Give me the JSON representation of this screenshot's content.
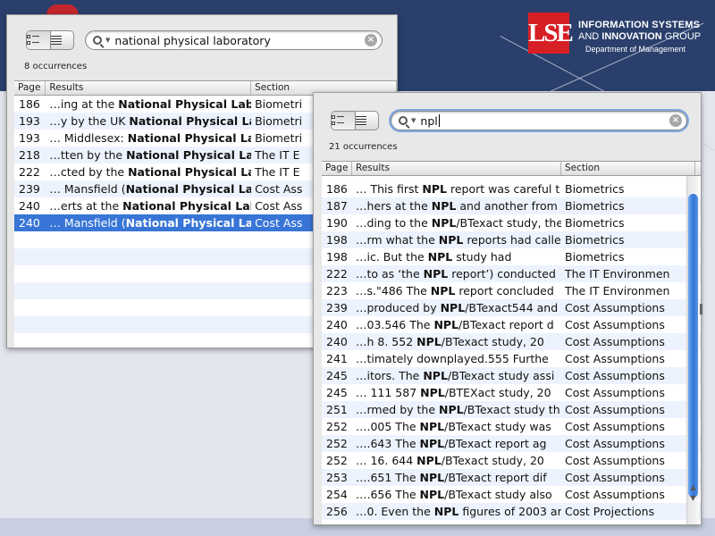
{
  "brand": {
    "logo_text": "LSE",
    "line1": "INFORMATION SYSTEMS",
    "line2a": "AND ",
    "line2b": "INNOVATION",
    "line2c": " GROUP",
    "line3": "Department of Management",
    "colors": {
      "lse_red": "#d71f26",
      "header_navy": "#2a3f6b",
      "selection_blue": "#3875d7"
    }
  },
  "window1": {
    "search_query": "national physical laboratory",
    "occurrences": "8 occurrences",
    "columns": [
      "Page",
      "Results",
      "Section"
    ],
    "rows": [
      {
        "page": "186",
        "pre": "…ing at the ",
        "bold": "National Physical Labo",
        "post": "",
        "section": "Biometri"
      },
      {
        "page": "193",
        "pre": "…y by the UK ",
        "bold": "National Physical Lab",
        "post": "",
        "section": "Biometri"
      },
      {
        "page": "193",
        "pre": "… Middlesex: ",
        "bold": "National Physical Lab",
        "post": "",
        "section": "Biometri"
      },
      {
        "page": "218",
        "pre": "…tten by the ",
        "bold": "National Physical Labo",
        "post": "",
        "section": "The IT E"
      },
      {
        "page": "222",
        "pre": "…cted by the ",
        "bold": "National Physical Labo",
        "post": "",
        "section": "The IT E"
      },
      {
        "page": "239",
        "pre": "… Mansfield (",
        "bold": "National Physical Labo",
        "post": "",
        "section": "Cost Ass"
      },
      {
        "page": "240",
        "pre": "…erts at the ",
        "bold": "National Physical Labo",
        "post": "",
        "section": "Cost Ass"
      },
      {
        "page": "240",
        "pre": "… Mansfield (",
        "bold": "National Physical Labo",
        "post": "",
        "section": "Cost Ass"
      }
    ],
    "selected_row_index": 7
  },
  "window2": {
    "search_query": "npl",
    "occurrences": "21 occurrences",
    "columns": [
      "Page",
      "Results",
      "Section"
    ],
    "rows": [
      {
        "page": "186",
        "pre": "… This first ",
        "bold": "NPL",
        "post": " report was careful t",
        "section": "Biometrics"
      },
      {
        "page": "187",
        "pre": "…hers at the ",
        "bold": "NPL",
        "post": " and another from",
        "section": "Biometrics"
      },
      {
        "page": "190",
        "pre": "…ding to the ",
        "bold": "NPL",
        "post": "/BTexact study, the",
        "section": "Biometrics"
      },
      {
        "page": "198",
        "pre": "…rm what the ",
        "bold": "NPL",
        "post": " reports had  calle",
        "section": "Biometrics"
      },
      {
        "page": "198",
        "pre": "…ic. But the ",
        "bold": "NPL",
        "post": " study had",
        "section": "Biometrics"
      },
      {
        "page": "222",
        "pre": "…to as  ‘the ",
        "bold": "NPL",
        "post": " report’) conducted",
        "section": "The IT Environmen"
      },
      {
        "page": "223",
        "pre": "…s.\"486  The ",
        "bold": "NPL",
        "post": " report concluded",
        "section": "The IT Environmen"
      },
      {
        "page": "239",
        "pre": "…produced by ",
        "bold": "NPL",
        "post": "/BTexact544 and",
        "section": "Cost Assumptions"
      },
      {
        "page": "240",
        "pre": "…03.546  The ",
        "bold": "NPL",
        "post": "/BTexact report d",
        "section": "Cost Assumptions"
      },
      {
        "page": "240",
        "pre": "…h 8.  552   ",
        "bold": "NPL",
        "post": "/BTexact study, 20",
        "section": "Cost Assumptions"
      },
      {
        "page": "241",
        "pre": "…timately downplayed.555   Furthe",
        "bold": "",
        "post": "",
        "section": "Cost Assumptions"
      },
      {
        "page": "245",
        "pre": "…itors.  The ",
        "bold": "NPL",
        "post": "/BTexact study assi",
        "section": "Cost Assumptions"
      },
      {
        "page": "245",
        "pre": "… 111  587   ",
        "bold": "NPL",
        "post": "/BTEXact study, 20",
        "section": "Cost Assumptions"
      },
      {
        "page": "251",
        "pre": "…rmed by the ",
        "bold": "NPL",
        "post": "/BTexact  study th",
        "section": "Cost Assumptions"
      },
      {
        "page": "252",
        "pre": "….005     The ",
        "bold": "NPL",
        "post": "/BTexact study was",
        "section": "Cost Assumptions"
      },
      {
        "page": "252",
        "pre": "….643     The ",
        "bold": "NPL",
        "post": "/BTexact report ag",
        "section": "Cost Assumptions"
      },
      {
        "page": "252",
        "pre": "… 16.  644   ",
        "bold": "NPL",
        "post": "/BTexact study, 20",
        "section": "Cost Assumptions"
      },
      {
        "page": "253",
        "pre": "….651     The ",
        "bold": "NPL",
        "post": "/BTexact report dif",
        "section": "Cost Assumptions"
      },
      {
        "page": "254",
        "pre": "….656     The ",
        "bold": "NPL",
        "post": "/BTexact study also",
        "section": "Cost Assumptions"
      },
      {
        "page": "256",
        "pre": "…0. Even the ",
        "bold": "NPL",
        "post": " figures of 2003 ar",
        "section": "Cost Projections"
      }
    ]
  }
}
